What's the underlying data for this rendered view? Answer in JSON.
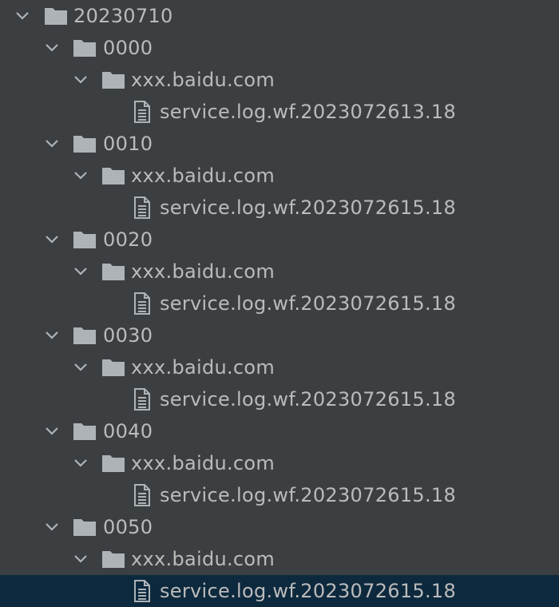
{
  "tree": {
    "root": {
      "label": "20230710",
      "expanded": true,
      "icon": "folder-icon"
    },
    "folders": [
      {
        "label": "0000",
        "subfolder": "xxx.baidu.com",
        "file": "service.log.wf.2023072613.18"
      },
      {
        "label": "0010",
        "subfolder": "xxx.baidu.com",
        "file": "service.log.wf.2023072615.18"
      },
      {
        "label": "0020",
        "subfolder": "xxx.baidu.com",
        "file": "service.log.wf.2023072615.18"
      },
      {
        "label": "0030",
        "subfolder": "xxx.baidu.com",
        "file": "service.log.wf.2023072615.18"
      },
      {
        "label": "0040",
        "subfolder": "xxx.baidu.com",
        "file": "service.log.wf.2023072615.18"
      },
      {
        "label": "0050",
        "subfolder": "xxx.baidu.com",
        "file": "service.log.wf.2023072615.18",
        "selected": true
      }
    ]
  },
  "colors": {
    "background": "#3c3f41",
    "text": "#bbbbbb",
    "icon": "#aeb3b8",
    "selection": "#0d293e"
  }
}
